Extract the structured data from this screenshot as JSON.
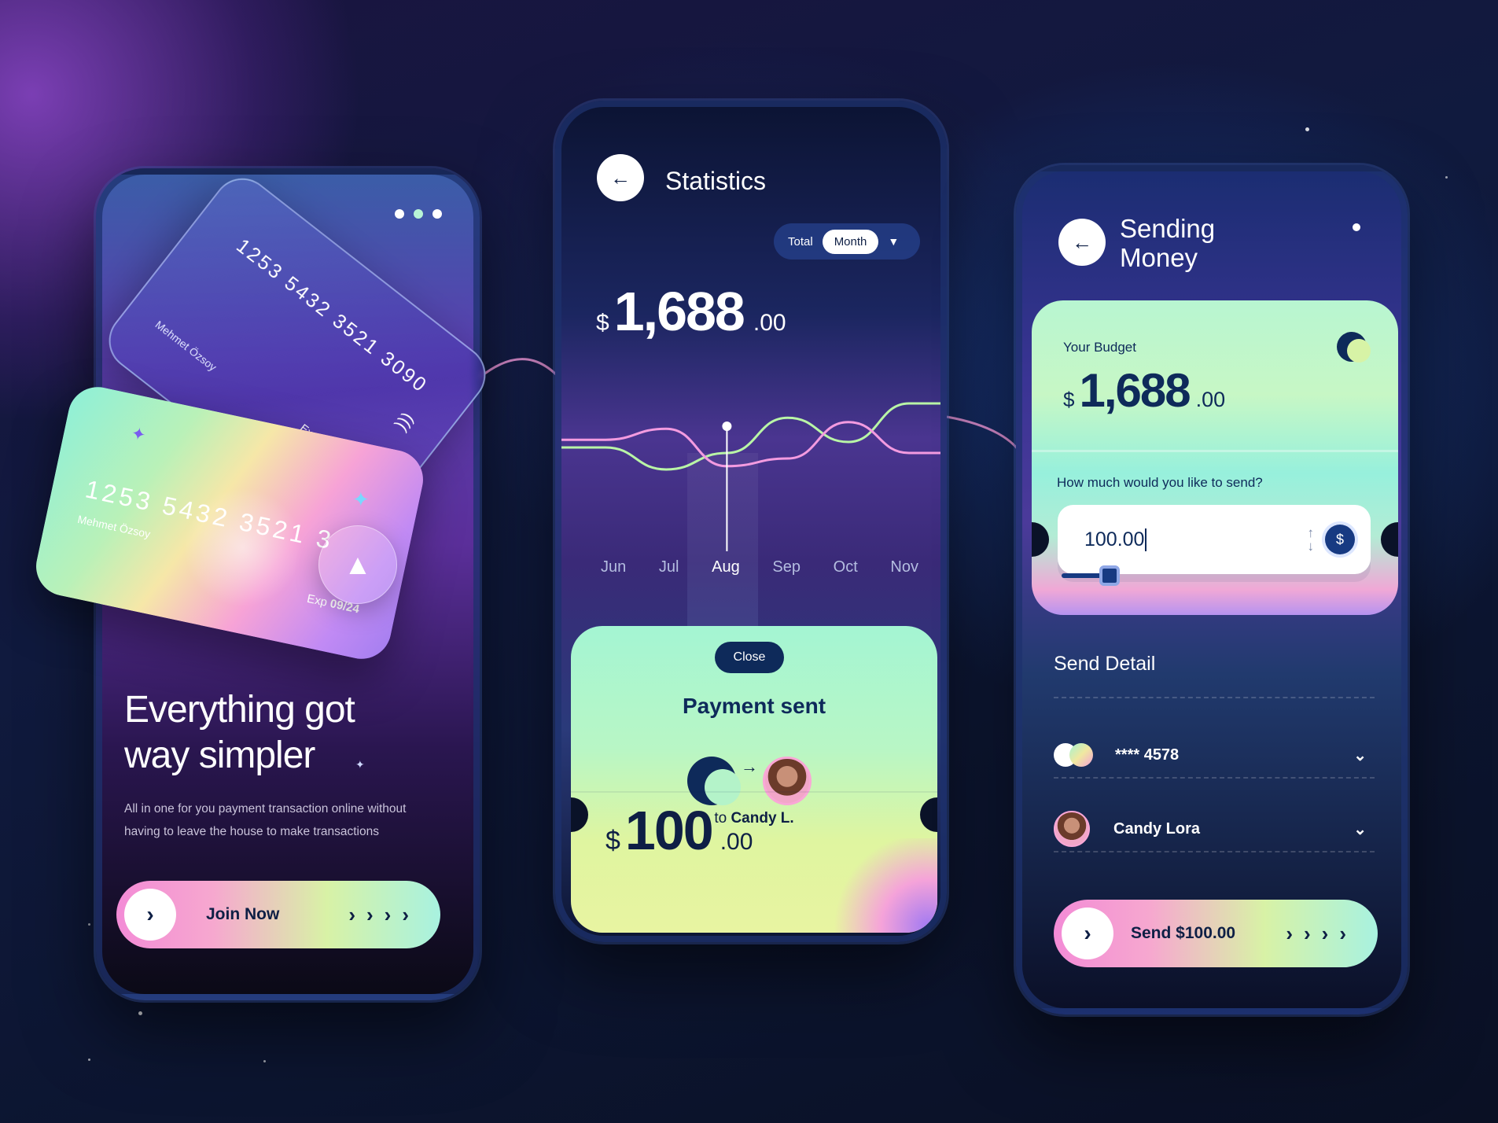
{
  "colors": {
    "navy": "#0e2a5a",
    "accent_pink": "#f38bd6",
    "accent_mint": "#a8f2e0",
    "chart_pink": "#f39be0",
    "chart_green": "#b9f5a6"
  },
  "onboarding": {
    "menu_icon": "three-dots-icon",
    "card_back": {
      "number": "1253 5432 3521 3090",
      "holder": "Mehmet Özsoy",
      "expiry": "Exp 09"
    },
    "card_front": {
      "number": "1253 5432 3521 3",
      "holder": "Mehmet Özsoy",
      "expiry_label": "Exp",
      "expiry_value": "09/24"
    },
    "headline": "Everything got way simpler",
    "subtext": "All in one for you payment transaction online without having to leave the house to make transactions",
    "cta_label": "Join Now"
  },
  "statistics": {
    "title": "Statistics",
    "toggle": {
      "left": "Total",
      "right": "Month"
    },
    "currency": "$",
    "amount_main": "1,688",
    "amount_dec": ".00",
    "months": [
      "Jun",
      "Jul",
      "Aug",
      "Sep",
      "Oct",
      "Nov"
    ],
    "selected_month": "Aug",
    "payment": {
      "close_label": "Close",
      "title": "Payment sent",
      "to_prefix": "to",
      "to_name": "Candy L.",
      "currency": "$",
      "amount_main": "100",
      "amount_dec": ".00"
    }
  },
  "chart_data": {
    "type": "line",
    "x": [
      "Jun",
      "Jul",
      "Aug",
      "Sep",
      "Oct",
      "Nov"
    ],
    "series": [
      {
        "values": [
          0.55,
          0.35,
          0.5,
          0.82,
          0.6,
          0.95
        ],
        "color": "#b9f5a6"
      },
      {
        "values": [
          0.62,
          0.72,
          0.38,
          0.45,
          0.78,
          0.5
        ],
        "color": "#f39be0"
      }
    ],
    "ylim": [
      0,
      1
    ],
    "grid": false
  },
  "sending": {
    "title_line1": "Sending",
    "title_line2": "Money",
    "budget_label": "Your Budget",
    "currency": "$",
    "budget_main": "1,688",
    "budget_dec": ".00",
    "question": "How much would you like to send?",
    "input_value": "100.00",
    "slider_fraction": 0.17,
    "send_detail_label": "Send Detail",
    "card_masked": "**** 4578",
    "recipient_name": "Candy Lora",
    "cta_label": "Send $100.00"
  }
}
